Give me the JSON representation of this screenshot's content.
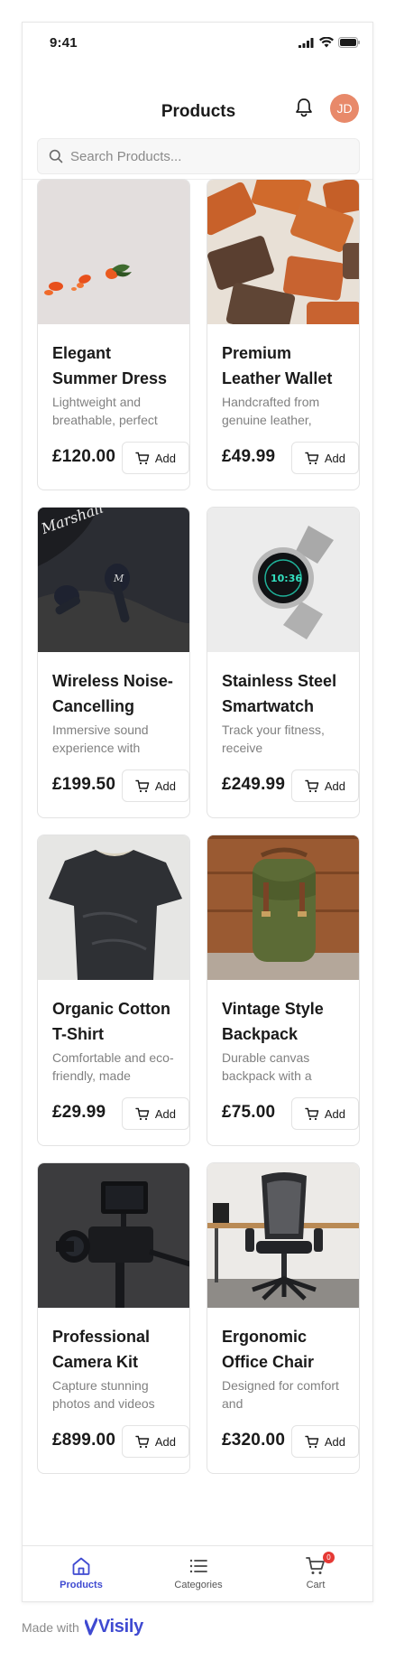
{
  "status_bar": {
    "time": "9:41"
  },
  "header": {
    "title": "Products",
    "avatar_initials": "JD",
    "avatar_color": "#e8896a"
  },
  "search": {
    "placeholder": "Search Products..."
  },
  "products": [
    {
      "name": "Elegant Summer Dress",
      "description": "Lightweight and breathable, perfect",
      "price": "£120.00",
      "add_label": "Add",
      "image": "dress-petals"
    },
    {
      "name": "Premium Leather Wallet",
      "description": "Handcrafted from genuine leather,",
      "price": "£49.99",
      "add_label": "Add",
      "image": "leather-wallets"
    },
    {
      "name": "Wireless Noise-Cancelling",
      "description": "Immersive sound experience with",
      "price": "£199.50",
      "add_label": "Add",
      "image": "earbuds"
    },
    {
      "name": "Stainless Steel Smartwatch",
      "description": "Track your fitness, receive",
      "price": "£249.99",
      "add_label": "Add",
      "image": "smartwatch"
    },
    {
      "name": "Organic Cotton T-Shirt",
      "description": "Comfortable and eco-friendly, made",
      "price": "£29.99",
      "add_label": "Add",
      "image": "tshirt"
    },
    {
      "name": "Vintage Style Backpack",
      "description": "Durable canvas backpack with a",
      "price": "£75.00",
      "add_label": "Add",
      "image": "backpack"
    },
    {
      "name": "Professional Camera Kit",
      "description": "Capture stunning photos and videos",
      "price": "£899.00",
      "add_label": "Add",
      "image": "camera"
    },
    {
      "name": "Ergonomic Office Chair",
      "description": "Designed for comfort and",
      "price": "£320.00",
      "add_label": "Add",
      "image": "office-chair"
    }
  ],
  "image_texts": {
    "earbuds_case_brand": "Marshall",
    "watch_time": "10:36"
  },
  "tabbar": {
    "tabs": [
      {
        "label": "Products",
        "icon": "home-icon",
        "active": true
      },
      {
        "label": "Categories",
        "icon": "list-icon",
        "active": false
      },
      {
        "label": "Cart",
        "icon": "cart-icon",
        "active": false
      }
    ],
    "cart_badge": "0"
  },
  "footer": {
    "made_with": "Made with",
    "brand": "Visily"
  },
  "colors": {
    "accent": "#3f4ad1",
    "badge": "#e53935"
  }
}
